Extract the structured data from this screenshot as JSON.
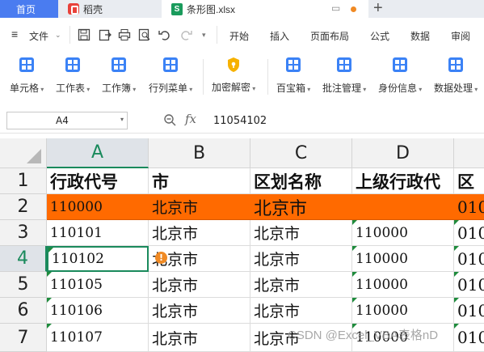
{
  "tabs": {
    "home": "首页",
    "docer": "稻壳",
    "file": "条形图.xlsx"
  },
  "menu": {
    "file": "文件",
    "items": [
      "开始",
      "插入",
      "页面布局",
      "公式",
      "数据",
      "审阅"
    ]
  },
  "ribbon": {
    "items": [
      "单元格",
      "工作表",
      "工作簿",
      "行列菜单",
      "加密解密",
      "百宝箱",
      "批注管理",
      "身份信息",
      "数据处理"
    ]
  },
  "formula_bar": {
    "name_box": "A4",
    "fx": "fx",
    "value": "11054102"
  },
  "grid": {
    "columns": [
      "A",
      "B",
      "C",
      "D"
    ],
    "rows": [
      "1",
      "2",
      "3",
      "4",
      "5",
      "6",
      "7"
    ],
    "active_column": "A",
    "active_row": "4",
    "header_row": [
      "行政代号",
      "市",
      "区划名称",
      "上级行政代",
      "区"
    ],
    "data": [
      [
        "110000",
        "北京市",
        "北京市",
        "",
        "010"
      ],
      [
        "110101",
        "北京市",
        "北京市",
        "110000",
        "010"
      ],
      [
        "110102",
        "北京市",
        "北京市",
        "110000",
        "010"
      ],
      [
        "110105",
        "北京市",
        "北京市",
        "110000",
        "010"
      ],
      [
        "110106",
        "北京市",
        "北京市",
        "110000",
        "010"
      ],
      [
        "110107",
        "北京市",
        "北京市",
        "110000",
        "010"
      ]
    ],
    "highlight_color": "#ff6a00"
  },
  "watermark": "CSDN @Excel_VBA表格nD"
}
